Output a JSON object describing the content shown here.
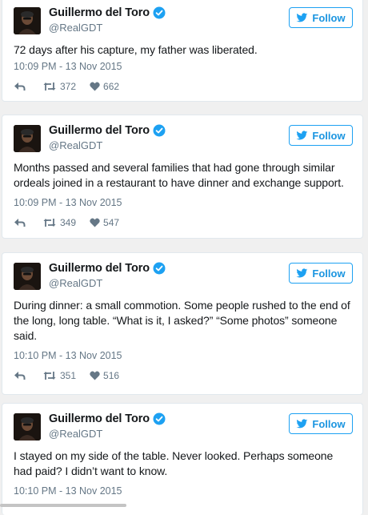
{
  "colors": {
    "accent": "#1da1f2",
    "name": "#14171a",
    "meta": "#657786",
    "border": "#e1e8ed"
  },
  "tweets": [
    {
      "author": "Guillermo del Toro",
      "handle": "@RealGDT",
      "follow_label": "Follow",
      "text": "72 days after his capture, my father was liberated.",
      "timestamp": "10:09 PM - 13 Nov 2015",
      "retweets": "372",
      "likes": "662"
    },
    {
      "author": "Guillermo del Toro",
      "handle": "@RealGDT",
      "follow_label": "Follow",
      "text": "Months passed and several families that had gone through similar ordeals joined in a restaurant to have dinner and exchange support.",
      "timestamp": "10:09 PM - 13 Nov 2015",
      "retweets": "349",
      "likes": "547"
    },
    {
      "author": "Guillermo del Toro",
      "handle": "@RealGDT",
      "follow_label": "Follow",
      "text": "During dinner: a small commotion. Some people rushed to the end of the long, long table. “What is it, I asked?” “Some photos” someone said.",
      "timestamp": "10:10 PM - 13 Nov 2015",
      "retweets": "351",
      "likes": "516"
    },
    {
      "author": "Guillermo del Toro",
      "handle": "@RealGDT",
      "follow_label": "Follow",
      "text": "I stayed on my side of the table. Never looked. Perhaps someone had paid? I didn’t want to know.",
      "timestamp": "10:10 PM - 13 Nov 2015"
    }
  ]
}
